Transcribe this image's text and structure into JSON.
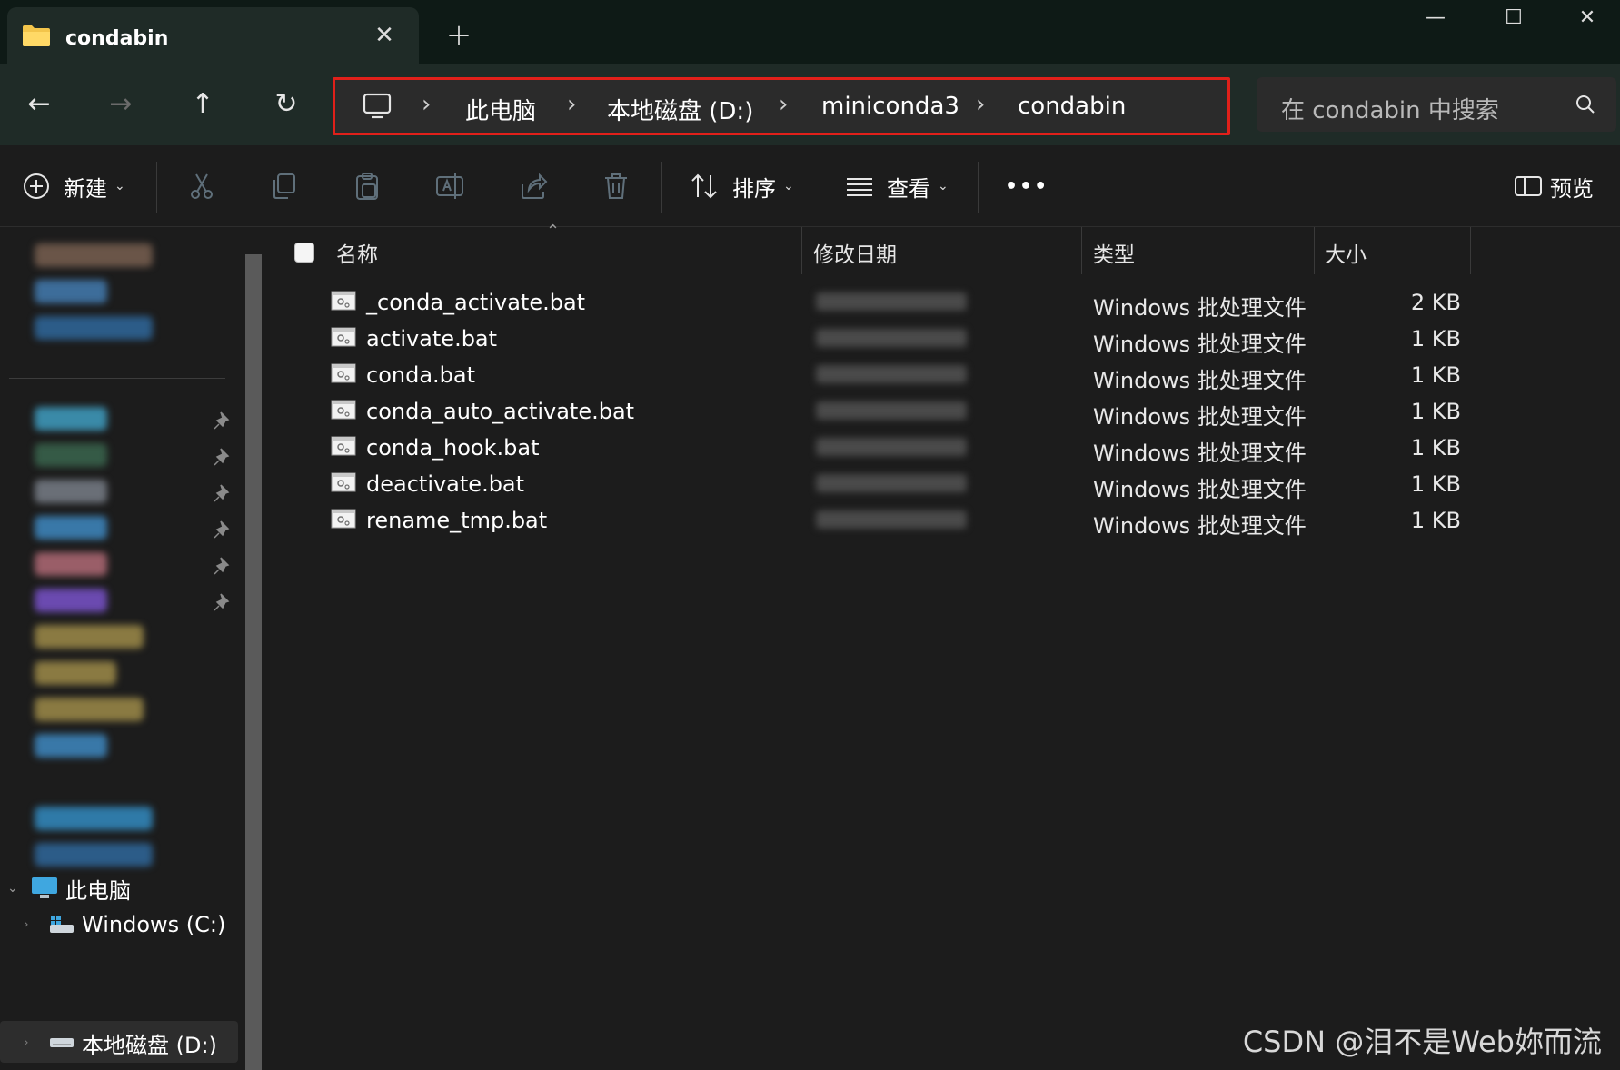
{
  "window": {
    "tab_title": "condabin",
    "tab_close": "✕",
    "new_tab": "+",
    "minimize": "—",
    "maximize": "☐",
    "close": "✕"
  },
  "nav": {
    "back": "←",
    "forward": "→",
    "up": "↑",
    "refresh": "↻"
  },
  "address": {
    "crumbs": [
      "此电脑",
      "本地磁盘 (D:)",
      "miniconda3",
      "condabin"
    ],
    "separator": "›",
    "highlight_color": "#e0201a"
  },
  "search": {
    "placeholder": "在 condabin 中搜索"
  },
  "toolbar": {
    "new_label": "新建",
    "sort_label": "排序",
    "view_label": "查看",
    "more_label": "•••",
    "preview_label": "预览"
  },
  "columns": {
    "name": "名称",
    "date": "修改日期",
    "type": "类型",
    "size": "大小"
  },
  "files": [
    {
      "name": "_conda_activate.bat",
      "type": "Windows 批处理文件",
      "size": "2 KB"
    },
    {
      "name": "activate.bat",
      "type": "Windows 批处理文件",
      "size": "1 KB"
    },
    {
      "name": "conda.bat",
      "type": "Windows 批处理文件",
      "size": "1 KB"
    },
    {
      "name": "conda_auto_activate.bat",
      "type": "Windows 批处理文件",
      "size": "1 KB"
    },
    {
      "name": "conda_hook.bat",
      "type": "Windows 批处理文件",
      "size": "1 KB"
    },
    {
      "name": "deactivate.bat",
      "type": "Windows 批处理文件",
      "size": "1 KB"
    },
    {
      "name": "rename_tmp.bat",
      "type": "Windows 批处理文件",
      "size": "1 KB"
    }
  ],
  "sidebar": {
    "this_pc": "此电脑",
    "drive_c": "Windows (C:)",
    "drive_d": "本地磁盘 (D:)"
  },
  "watermark": "CSDN @泪不是Web妳而流"
}
